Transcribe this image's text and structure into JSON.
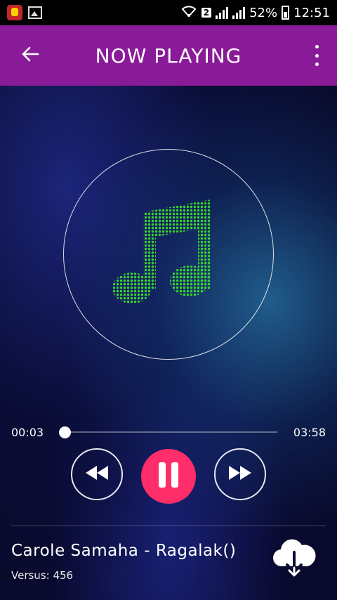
{
  "status_bar": {
    "sim_badge": "2",
    "battery": "52%",
    "time": "12:51"
  },
  "app_bar": {
    "title": "NOW PLAYING"
  },
  "player": {
    "current_time": "00:03",
    "total_time": "03:58",
    "progress": 0.013
  },
  "track": {
    "title": "Carole Samaha - Ragalak()",
    "version": "Versus: 456"
  },
  "colors": {
    "app_bar": "#8a1b98",
    "play_button": "#ff2d6a",
    "note": "#39d12e"
  }
}
